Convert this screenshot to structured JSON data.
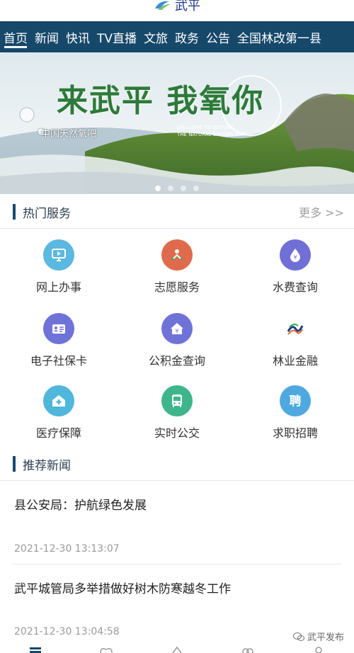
{
  "app": {
    "title": "武平"
  },
  "nav": {
    "items": [
      "首页",
      "新闻",
      "快讯",
      "TV直播",
      "文旅",
      "政务",
      "公告",
      "全国林改第一县"
    ]
  },
  "banner": {
    "headline": "来武平 我氧你",
    "tagline": "中国天然氧吧",
    "english_line1": "WELCOME TO WUPING,",
    "english_line2": "THE NATURAL OXYGEN BAR",
    "slide_count": 4,
    "active_slide": 1
  },
  "hot_services": {
    "title": "热门服务",
    "more": "更多 >>",
    "items": [
      {
        "label": "网上办事",
        "icon": "monitor-icon",
        "color": "#5bb8e0"
      },
      {
        "label": "志愿服务",
        "icon": "volunteer-icon",
        "color": "#e06a4c"
      },
      {
        "label": "水费查询",
        "icon": "water-drop-icon",
        "color": "#6f6fd6"
      },
      {
        "label": "电子社保卡",
        "icon": "id-card-icon",
        "color": "#6f73d8"
      },
      {
        "label": "公积金查询",
        "icon": "house-fund-icon",
        "color": "#6f73d8"
      },
      {
        "label": "林业金融",
        "icon": "forestry-finance-icon",
        "color": "#1d3d8c"
      },
      {
        "label": "医疗保障",
        "icon": "medical-icon",
        "color": "#4fb6dc"
      },
      {
        "label": "实时公交",
        "icon": "bus-icon",
        "color": "#3fb58c"
      },
      {
        "label": "求职招聘",
        "icon": "job-icon",
        "color": "#4fa9e0"
      }
    ]
  },
  "recommended_news": {
    "title": "推荐新闻",
    "items": [
      {
        "title": "县公安局：护航绿色发展",
        "time": "2021-12-30 13:13:07"
      },
      {
        "title": "武平城管局多举措做好树木防寒越冬工作",
        "time": "2021-12-30 13:04:58"
      }
    ]
  },
  "watermark": "武平发布"
}
